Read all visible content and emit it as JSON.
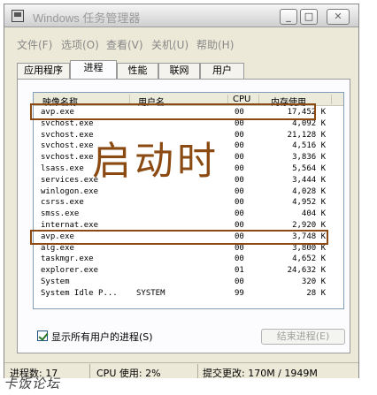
{
  "window": {
    "title": "Windows 任务管理器",
    "buttons": {
      "minimize": "_",
      "maximize": "□",
      "close": "✕"
    }
  },
  "menu": [
    "文件(F)",
    "选项(O)",
    "查看(V)",
    "关机(U)",
    "帮助(H)"
  ],
  "tabs": [
    {
      "label": "应用程序",
      "active": false
    },
    {
      "label": "进程",
      "active": true
    },
    {
      "label": "性能",
      "active": false
    },
    {
      "label": "联网",
      "active": false
    },
    {
      "label": "用户",
      "active": false
    }
  ],
  "process_table": {
    "columns": [
      "映像名称",
      "用户名",
      "CPU",
      "内存使用"
    ],
    "rows": [
      {
        "name": "avp.exe",
        "user": "",
        "cpu": "00",
        "mem": "17,452 K"
      },
      {
        "name": "svchost.exe",
        "user": "",
        "cpu": "00",
        "mem": "4,092 K"
      },
      {
        "name": "svchost.exe",
        "user": "",
        "cpu": "00",
        "mem": "21,128 K"
      },
      {
        "name": "svchost.exe",
        "user": "",
        "cpu": "00",
        "mem": "4,516 K"
      },
      {
        "name": "svchost.exe",
        "user": "",
        "cpu": "00",
        "mem": "3,836 K"
      },
      {
        "name": "lsass.exe",
        "user": "",
        "cpu": "00",
        "mem": "5,564 K"
      },
      {
        "name": "services.exe",
        "user": "",
        "cpu": "00",
        "mem": "3,444 K"
      },
      {
        "name": "winlogon.exe",
        "user": "",
        "cpu": "00",
        "mem": "4,028 K"
      },
      {
        "name": "csrss.exe",
        "user": "",
        "cpu": "00",
        "mem": "4,952 K"
      },
      {
        "name": "smss.exe",
        "user": "",
        "cpu": "00",
        "mem": "404 K"
      },
      {
        "name": "internat.exe",
        "user": "",
        "cpu": "00",
        "mem": "2,920 K"
      },
      {
        "name": "avp.exe",
        "user": "",
        "cpu": "00",
        "mem": "3,748 K"
      },
      {
        "name": "alg.exe",
        "user": "",
        "cpu": "00",
        "mem": "3,800 K"
      },
      {
        "name": "taskmgr.exe",
        "user": "",
        "cpu": "00",
        "mem": "4,652 K"
      },
      {
        "name": "explorer.exe",
        "user": "",
        "cpu": "01",
        "mem": "24,632 K"
      },
      {
        "name": "System",
        "user": "",
        "cpu": "00",
        "mem": "320 K"
      },
      {
        "name": "System Idle P...",
        "user": "SYSTEM",
        "cpu": "99",
        "mem": "28 K"
      }
    ]
  },
  "annotation": {
    "text": "启动时",
    "color": "#8b4a14",
    "highlighted_rows": [
      0,
      11
    ]
  },
  "show_all_users": {
    "label": "显示所有用户的进程(S)",
    "checked": true
  },
  "end_process_button": "结束进程(E)",
  "status": {
    "processes": "进程数: 17",
    "cpu": "CPU 使用: 2%",
    "commit": "提交更改: 170M / 1949M"
  },
  "watermark": "卡饭论坛"
}
